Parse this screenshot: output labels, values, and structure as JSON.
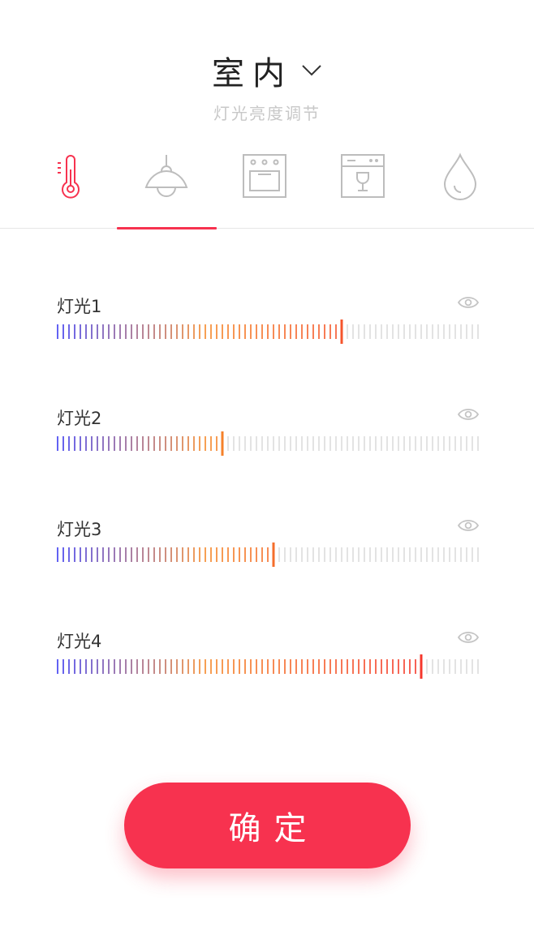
{
  "header": {
    "title": "室内",
    "subtitle": "灯光亮度调节"
  },
  "tabs": [
    {
      "icon": "thermometer-icon",
      "active": false
    },
    {
      "icon": "lamp-icon",
      "active": true
    },
    {
      "icon": "oven-icon",
      "active": false
    },
    {
      "icon": "dishwasher-icon",
      "active": false
    },
    {
      "icon": "water-drop-icon",
      "active": false
    }
  ],
  "colors": {
    "accent": "#f7324f",
    "tick_start": "#3b3bf0",
    "tick_mid": "#f5882a",
    "tick_end": "#f5222d",
    "tick_inactive": "#dcdcdc"
  },
  "sliders": [
    {
      "label": "灯光1",
      "level": 0.68
    },
    {
      "label": "灯光2",
      "level": 0.39
    },
    {
      "label": "灯光3",
      "level": 0.51
    },
    {
      "label": "灯光4",
      "level": 0.86
    }
  ],
  "confirm_label": "确定"
}
